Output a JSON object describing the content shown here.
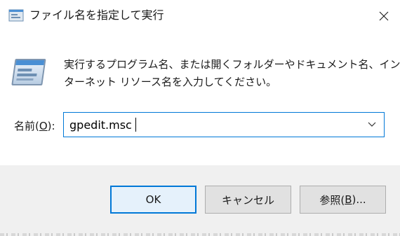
{
  "window": {
    "title": "ファイル名を指定して実行",
    "close_icon": "close-icon",
    "title_icon": "run-dialog-icon"
  },
  "content": {
    "description_line1": "実行するプログラム名、または開くフォルダーやドキュメント名、イン",
    "description_line2": "ターネット リソース名を入力してください。",
    "name_label_prefix": "名前(",
    "name_label_access_key": "O",
    "name_label_suffix": "):",
    "name_value": "gpedit.msc",
    "dropdown_icon": "chevron-down-icon"
  },
  "buttons": {
    "ok_label": "OK",
    "cancel_label": "キャンセル",
    "browse_label_prefix": "参照(",
    "browse_access_key": "B",
    "browse_label_suffix": ")..."
  },
  "colors": {
    "accent": "#0078d7",
    "footer_bg": "#f0f0f0",
    "button_bg": "#e1e1e1",
    "default_button_bg": "#e5f1fb"
  }
}
